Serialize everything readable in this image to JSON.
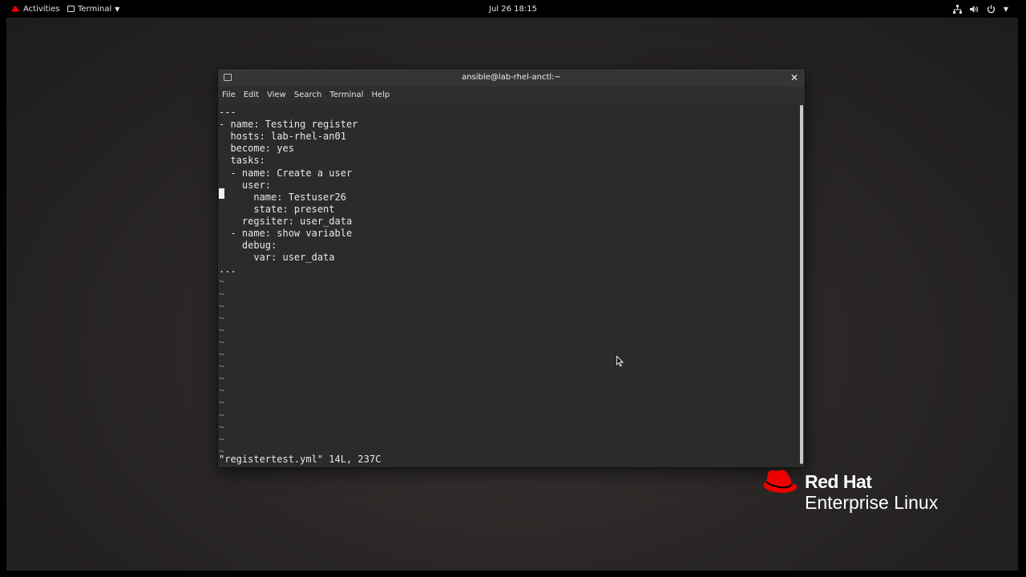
{
  "topbar": {
    "activities_label": "Activities",
    "app_label": "Terminal",
    "clock": "Jul 26  18:15"
  },
  "window": {
    "title": "ansible@lab-rhel-anctl:~",
    "menu": [
      "File",
      "Edit",
      "View",
      "Search",
      "Terminal",
      "Help"
    ]
  },
  "editor": {
    "lines": [
      "---",
      "- name: Testing register",
      "  hosts: lab-rhel-an01",
      "  become: yes",
      "  tasks:",
      "  - name: Create a user",
      "    user:",
      "      name: Testuser26",
      "      state: present",
      "    regsiter: user_data",
      "  - name: show variable",
      "    debug:",
      "      var: user_data",
      "..."
    ],
    "tilde_count": 15,
    "tilde_char": "~",
    "status": "\"registertest.yml\" 14L, 237C"
  },
  "branding": {
    "line1": "Red Hat",
    "line2": "Enterprise Linux",
    "logo_color": "#ee0000"
  },
  "colors": {
    "terminal_bg": "#2b2b2b",
    "titlebar_bg": "#353535",
    "topbar_bg": "#000000"
  },
  "icons": {
    "activities": "redhat-icon",
    "app": "terminal-icon",
    "tray": [
      "network-icon",
      "volume-icon",
      "power-icon",
      "chevron-down-icon"
    ],
    "window": [
      "terminal-icon",
      "close-icon"
    ]
  }
}
